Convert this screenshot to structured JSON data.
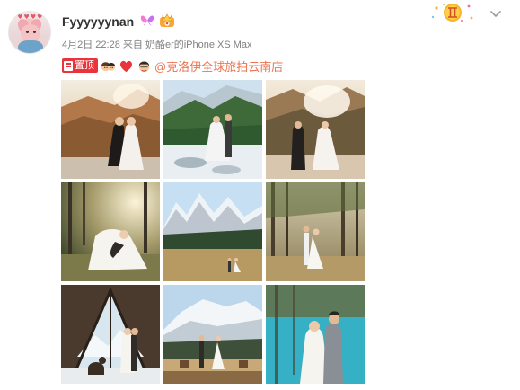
{
  "post": {
    "username": "Fyyyyyynan",
    "time": "4月2日 22:28",
    "source_prefix": "来自",
    "source": "奶酪er的iPhone XS Max",
    "pinned_label": "置顶",
    "mention": "@克洛伊全球旅拍云南店"
  },
  "icons": {
    "butterfly": "butterfly-badge-icon",
    "vip": "vip-crown-icon",
    "corner": "gemini-zodiac-badge-icon",
    "menu": "chevron-down-icon",
    "pin": "pin-top-icon",
    "emoji": [
      "couple-face-emoji",
      "red-heart-emoji",
      "groom-face-emoji"
    ]
  },
  "colors": {
    "accent_link": "#eb7350",
    "pin_red": "#e8343a",
    "meta_gray": "#808080"
  },
  "photos": [
    {
      "alt": "couple-kissing-autumn-hillside"
    },
    {
      "alt": "couple-standing-snowy-riverbank-pines"
    },
    {
      "alt": "couple-by-stream-sunlit-slopes"
    },
    {
      "alt": "bride-in-forest-sunlight"
    },
    {
      "alt": "couple-meadow-snowy-peaks"
    },
    {
      "alt": "couple-pine-forest-clearing"
    },
    {
      "alt": "couple-in-tent-with-dog-snow-mountains"
    },
    {
      "alt": "couple-on-deck-facing-snow-mountain"
    },
    {
      "alt": "couple-by-turquoise-lake"
    }
  ]
}
